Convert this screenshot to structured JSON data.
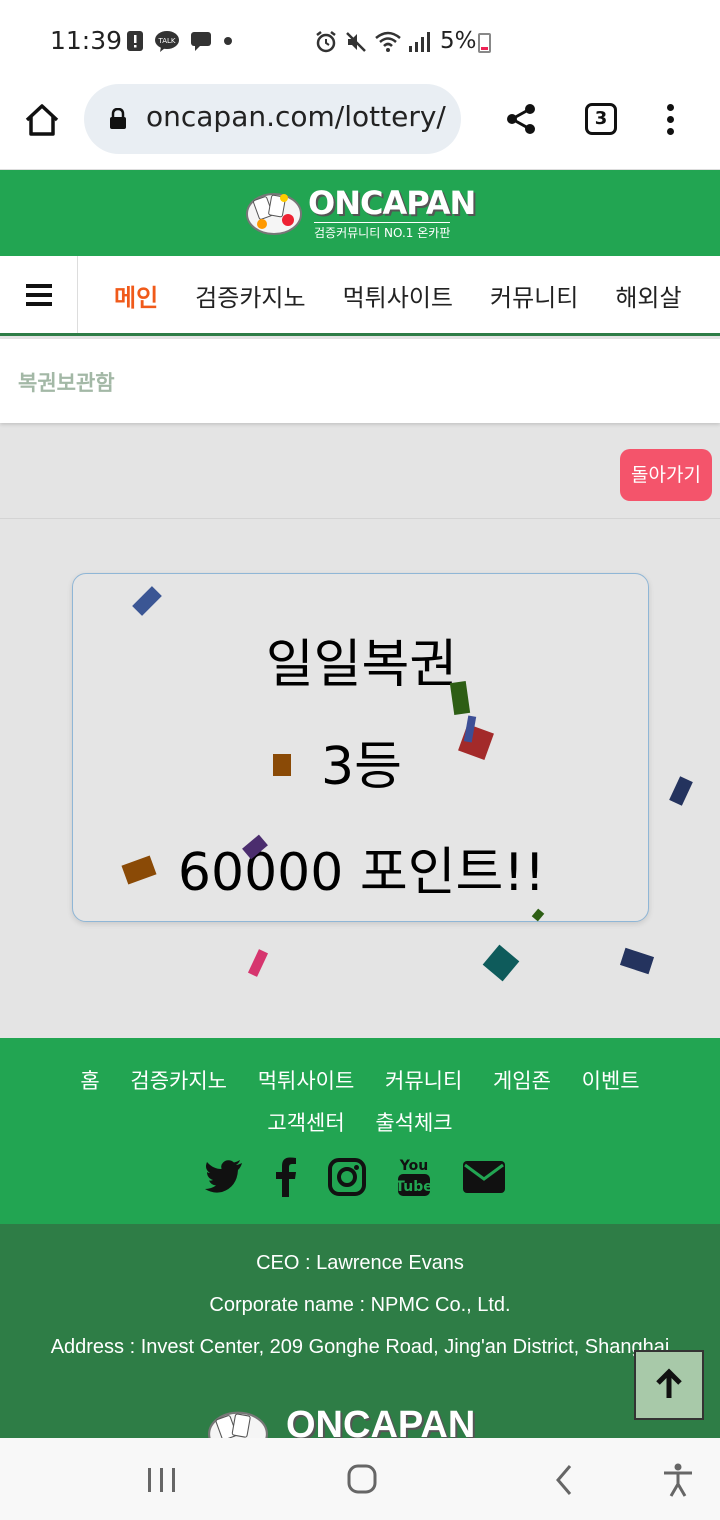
{
  "status_bar": {
    "time": "11:39",
    "battery": "5%",
    "icons_left": [
      "alert-icon",
      "talk-icon",
      "chat-icon",
      "dot-icon"
    ],
    "icons_right": [
      "alarm-icon",
      "mute-icon",
      "wifi-icon",
      "signal-icon",
      "battery-icon"
    ]
  },
  "browser": {
    "url": "oncapan.com/lottery/",
    "tab_count": "3"
  },
  "site": {
    "logo_text": "ONCAPAN",
    "logo_subtext": "검증커뮤니티 NO.1 온카판",
    "brand_color": "#22a552",
    "dark_green": "#2e7d46"
  },
  "nav": {
    "items": [
      {
        "label": "메인",
        "active": true
      },
      {
        "label": "검증카지노"
      },
      {
        "label": "먹튀사이트"
      },
      {
        "label": "커뮤니티"
      },
      {
        "label": "해외살"
      }
    ]
  },
  "breadcrumb": "복권보관함",
  "back_button": "돌아가기",
  "lottery": {
    "title": "일일복권",
    "rank": "3등",
    "points": "60000 포인트!!"
  },
  "footer": {
    "links": [
      "홈",
      "검증카지노",
      "먹튀사이트",
      "커뮤니티",
      "게임존",
      "이벤트",
      "고객센터",
      "출석체크"
    ],
    "social": [
      "twitter-icon",
      "facebook-icon",
      "instagram-icon",
      "youtube-icon",
      "email-icon"
    ],
    "ceo": "CEO : Lawrence Evans",
    "corporate": "Corporate name : NPMC Co., Ltd.",
    "address": "Address : Invest Center, 209 Gonghe Road, Jing'an District, Shanghai"
  }
}
